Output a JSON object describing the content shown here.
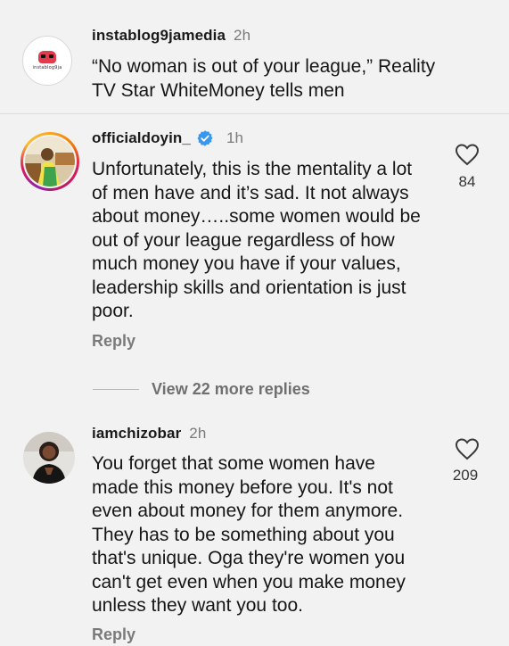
{
  "caption": {
    "username": "instablog9jamedia",
    "time": "2h",
    "text": "“No woman is out of your league,” Reality\nTV Star WhiteMoney tells men",
    "logo_text": "instablog9ja",
    "avatar_icon": "instablog9ja-logo-icon"
  },
  "comments": [
    {
      "username": "officialdoyin_",
      "verified": true,
      "time": "1h",
      "text": "Unfortunately, this is the mentality a lot\nof men have and it’s sad. It not always\nabout money…..some women would be\nout of your league regardless of how\nmuch money you have if your values,\nleadership skills and orientation is just\npoor.",
      "likes": "84",
      "reply_label": "Reply"
    },
    {
      "username": "iamchizobar",
      "verified": false,
      "time": "2h",
      "text": "You forget that some women have\nmade this money before you. It's not\neven about money for them anymore.\nThey has to be something about you\nthat's unique. Oga they're women you\ncan't get even when you make money\nunless they want you too.",
      "likes": "209",
      "reply_label": "Reply"
    }
  ],
  "view_more": "View 22 more replies",
  "colors": {
    "background": "#f2f2f2",
    "verified_blue": "#3897f0",
    "secondary_text": "#7a7a7a"
  }
}
